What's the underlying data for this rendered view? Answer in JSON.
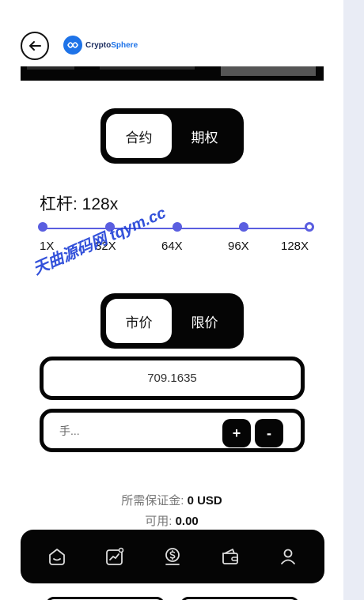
{
  "header": {
    "logo_text_a": "Crypto",
    "logo_text_b": "Sphere",
    "back_icon": "arrow-left-icon"
  },
  "contract_tabs": [
    "合约",
    "期权"
  ],
  "leverage": {
    "label": "杠杆: 128x",
    "ticks": [
      "1X",
      "32X",
      "64X",
      "96X",
      "128X"
    ],
    "selected": "128X"
  },
  "watermark": "天曲源码网 tqym.cc",
  "order_tabs": [
    "市价",
    "限价"
  ],
  "price_field": {
    "value": "709.1635"
  },
  "amount_field": {
    "placeholder": "手...",
    "plus": "+",
    "minus": "-"
  },
  "margin": {
    "label": "所需保证金:",
    "value": "0 USD",
    "available_label": "可用:",
    "available_value": "0.00"
  },
  "tabbar": [
    "home-icon",
    "market-icon",
    "trade-icon",
    "wallet-icon",
    "profile-icon"
  ],
  "colors": {
    "accent": "#5a5ee0",
    "dark": "#050505",
    "brand": "#1e73e8"
  }
}
